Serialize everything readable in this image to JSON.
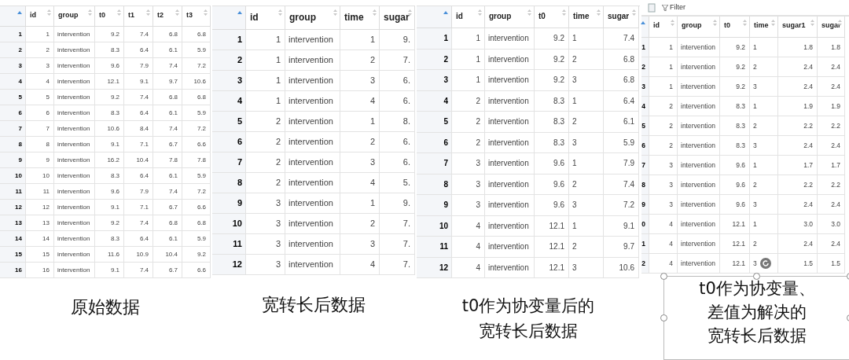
{
  "panels": [
    {
      "columns": [
        {
          "label": "id",
          "kind": "num"
        },
        {
          "label": "group",
          "kind": "chr"
        },
        {
          "label": "t0",
          "kind": "num"
        },
        {
          "label": "t1",
          "kind": "num"
        },
        {
          "label": "t2",
          "kind": "num"
        },
        {
          "label": "t3",
          "kind": "num"
        }
      ],
      "rows": [
        {
          "n": "1",
          "cells": [
            "1",
            "intervention",
            "9.2",
            "7.4",
            "6.8",
            "6.8"
          ]
        },
        {
          "n": "2",
          "cells": [
            "2",
            "intervention",
            "8.3",
            "6.4",
            "6.1",
            "5.9"
          ]
        },
        {
          "n": "3",
          "cells": [
            "3",
            "intervention",
            "9.6",
            "7.9",
            "7.4",
            "7.2"
          ]
        },
        {
          "n": "4",
          "cells": [
            "4",
            "intervention",
            "12.1",
            "9.1",
            "9.7",
            "10.6"
          ]
        },
        {
          "n": "5",
          "cells": [
            "5",
            "intervention",
            "9.2",
            "7.4",
            "6.8",
            "6.8"
          ]
        },
        {
          "n": "6",
          "cells": [
            "6",
            "intervention",
            "8.3",
            "6.4",
            "6.1",
            "5.9"
          ]
        },
        {
          "n": "7",
          "cells": [
            "7",
            "intervention",
            "10.6",
            "8.4",
            "7.4",
            "7.2"
          ]
        },
        {
          "n": "8",
          "cells": [
            "8",
            "intervention",
            "9.1",
            "7.1",
            "6.7",
            "6.6"
          ]
        },
        {
          "n": "9",
          "cells": [
            "9",
            "intervention",
            "16.2",
            "10.4",
            "7.8",
            "7.8"
          ]
        },
        {
          "n": "10",
          "cells": [
            "10",
            "intervention",
            "8.3",
            "6.4",
            "6.1",
            "5.9"
          ]
        },
        {
          "n": "11",
          "cells": [
            "11",
            "intervention",
            "9.6",
            "7.9",
            "7.4",
            "7.2"
          ]
        },
        {
          "n": "12",
          "cells": [
            "12",
            "intervention",
            "9.1",
            "7.1",
            "6.7",
            "6.6"
          ]
        },
        {
          "n": "13",
          "cells": [
            "13",
            "intervention",
            "9.2",
            "7.4",
            "6.8",
            "6.8"
          ]
        },
        {
          "n": "14",
          "cells": [
            "14",
            "intervention",
            "8.3",
            "6.4",
            "6.1",
            "5.9"
          ]
        },
        {
          "n": "15",
          "cells": [
            "15",
            "intervention",
            "11.6",
            "10.9",
            "10.4",
            "9.2"
          ]
        },
        {
          "n": "16",
          "cells": [
            "16",
            "intervention",
            "9.1",
            "7.4",
            "6.7",
            "6.6"
          ]
        }
      ],
      "caption": [
        "原始数据"
      ]
    },
    {
      "columns": [
        {
          "label": "id",
          "kind": "num"
        },
        {
          "label": "group",
          "kind": "chr"
        },
        {
          "label": "time",
          "kind": "num"
        },
        {
          "label": "sugar",
          "kind": "num"
        }
      ],
      "rows": [
        {
          "n": "1",
          "cells": [
            "1",
            "intervention",
            "1",
            "9."
          ]
        },
        {
          "n": "2",
          "cells": [
            "1",
            "intervention",
            "2",
            "7."
          ]
        },
        {
          "n": "3",
          "cells": [
            "1",
            "intervention",
            "3",
            "6."
          ]
        },
        {
          "n": "4",
          "cells": [
            "1",
            "intervention",
            "4",
            "6."
          ]
        },
        {
          "n": "5",
          "cells": [
            "2",
            "intervention",
            "1",
            "8."
          ]
        },
        {
          "n": "6",
          "cells": [
            "2",
            "intervention",
            "2",
            "6."
          ]
        },
        {
          "n": "7",
          "cells": [
            "2",
            "intervention",
            "3",
            "6."
          ]
        },
        {
          "n": "8",
          "cells": [
            "2",
            "intervention",
            "4",
            "5."
          ]
        },
        {
          "n": "9",
          "cells": [
            "3",
            "intervention",
            "1",
            "9."
          ]
        },
        {
          "n": "10",
          "cells": [
            "3",
            "intervention",
            "2",
            "7."
          ]
        },
        {
          "n": "11",
          "cells": [
            "3",
            "intervention",
            "3",
            "7."
          ]
        },
        {
          "n": "12",
          "cells": [
            "3",
            "intervention",
            "4",
            "7."
          ]
        }
      ],
      "caption": [
        "宽转长后数据"
      ]
    },
    {
      "columns": [
        {
          "label": "id",
          "kind": "num"
        },
        {
          "label": "group",
          "kind": "chr"
        },
        {
          "label": "t0",
          "kind": "num"
        },
        {
          "label": "time",
          "kind": "chr"
        },
        {
          "label": "sugar",
          "kind": "num"
        }
      ],
      "rows": [
        {
          "n": "1",
          "cells": [
            "1",
            "intervention",
            "9.2",
            "1",
            "7.4"
          ]
        },
        {
          "n": "2",
          "cells": [
            "1",
            "intervention",
            "9.2",
            "2",
            "6.8"
          ]
        },
        {
          "n": "3",
          "cells": [
            "1",
            "intervention",
            "9.2",
            "3",
            "6.8"
          ]
        },
        {
          "n": "4",
          "cells": [
            "2",
            "intervention",
            "8.3",
            "1",
            "6.4"
          ]
        },
        {
          "n": "5",
          "cells": [
            "2",
            "intervention",
            "8.3",
            "2",
            "6.1"
          ]
        },
        {
          "n": "6",
          "cells": [
            "2",
            "intervention",
            "8.3",
            "3",
            "5.9"
          ]
        },
        {
          "n": "7",
          "cells": [
            "3",
            "intervention",
            "9.6",
            "1",
            "7.9"
          ]
        },
        {
          "n": "8",
          "cells": [
            "3",
            "intervention",
            "9.6",
            "2",
            "7.4"
          ]
        },
        {
          "n": "9",
          "cells": [
            "3",
            "intervention",
            "9.6",
            "3",
            "7.2"
          ]
        },
        {
          "n": "10",
          "cells": [
            "4",
            "intervention",
            "12.1",
            "1",
            "9.1"
          ]
        },
        {
          "n": "11",
          "cells": [
            "4",
            "intervention",
            "12.1",
            "2",
            "9.7"
          ]
        },
        {
          "n": "12",
          "cells": [
            "4",
            "intervention",
            "12.1",
            "3",
            "10.6"
          ]
        }
      ],
      "caption": [
        "t0作为协变量后的",
        "宽转长后数据"
      ]
    },
    {
      "toolbar": {
        "filter": "Filter"
      },
      "columns": [
        {
          "label": "id",
          "kind": "num"
        },
        {
          "label": "group",
          "kind": "chr"
        },
        {
          "label": "t0",
          "kind": "num"
        },
        {
          "label": "time",
          "kind": "chr"
        },
        {
          "label": "sugar1",
          "kind": "num"
        },
        {
          "label": "sugar",
          "kind": "num"
        }
      ],
      "rows": [
        {
          "n": "1",
          "cells": [
            "1",
            "intervention",
            "9.2",
            "1",
            "1.8",
            "1.8"
          ]
        },
        {
          "n": "2",
          "cells": [
            "1",
            "intervention",
            "9.2",
            "2",
            "2.4",
            "2.4"
          ]
        },
        {
          "n": "3",
          "cells": [
            "1",
            "intervention",
            "9.2",
            "3",
            "2.4",
            "2.4"
          ]
        },
        {
          "n": "4",
          "cells": [
            "2",
            "intervention",
            "8.3",
            "1",
            "1.9",
            "1.9"
          ]
        },
        {
          "n": "5",
          "cells": [
            "2",
            "intervention",
            "8.3",
            "2",
            "2.2",
            "2.2"
          ]
        },
        {
          "n": "6",
          "cells": [
            "2",
            "intervention",
            "8.3",
            "3",
            "2.4",
            "2.4"
          ]
        },
        {
          "n": "7",
          "cells": [
            "3",
            "intervention",
            "9.6",
            "1",
            "1.7",
            "1.7"
          ]
        },
        {
          "n": "8",
          "cells": [
            "3",
            "intervention",
            "9.6",
            "2",
            "2.2",
            "2.2"
          ]
        },
        {
          "n": "9",
          "cells": [
            "3",
            "intervention",
            "9.6",
            "3",
            "2.4",
            "2.4"
          ]
        },
        {
          "n": "0",
          "cells": [
            "4",
            "intervention",
            "12.1",
            "1",
            "3.0",
            "3.0"
          ]
        },
        {
          "n": "1",
          "cells": [
            "4",
            "intervention",
            "12.1",
            "2",
            "2.4",
            "2.4"
          ]
        },
        {
          "n": "2",
          "cells": [
            "4",
            "intervention",
            "12.1",
            "3",
            "1.5",
            "1.5"
          ]
        }
      ],
      "caption": [
        "t0作为协变量、",
        "差值为解决的",
        "宽转长后数据"
      ],
      "caption_selected": true
    }
  ]
}
